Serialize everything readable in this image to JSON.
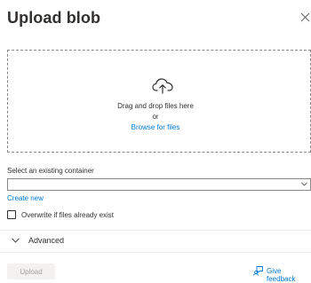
{
  "panel": {
    "title": "Upload blob"
  },
  "dropzone": {
    "drag_text": "Drag and drop files here",
    "or_text": "or",
    "browse_link": "Browse for files",
    "icon": "cloud-upload-icon"
  },
  "container": {
    "label": "Select an existing container",
    "value": "",
    "create_new": "Create new"
  },
  "overwrite": {
    "label": "Overwrite if files already exist",
    "checked": false
  },
  "advanced": {
    "label": "Advanced",
    "expanded": false
  },
  "footer": {
    "upload_label": "Upload",
    "upload_enabled": false,
    "feedback_label": "Give feedback"
  },
  "colors": {
    "accent": "#0078d4",
    "text": "#323130",
    "border": "#8a8886",
    "disabled_bg": "#f3f2f1",
    "disabled_text": "#a19f9d"
  }
}
